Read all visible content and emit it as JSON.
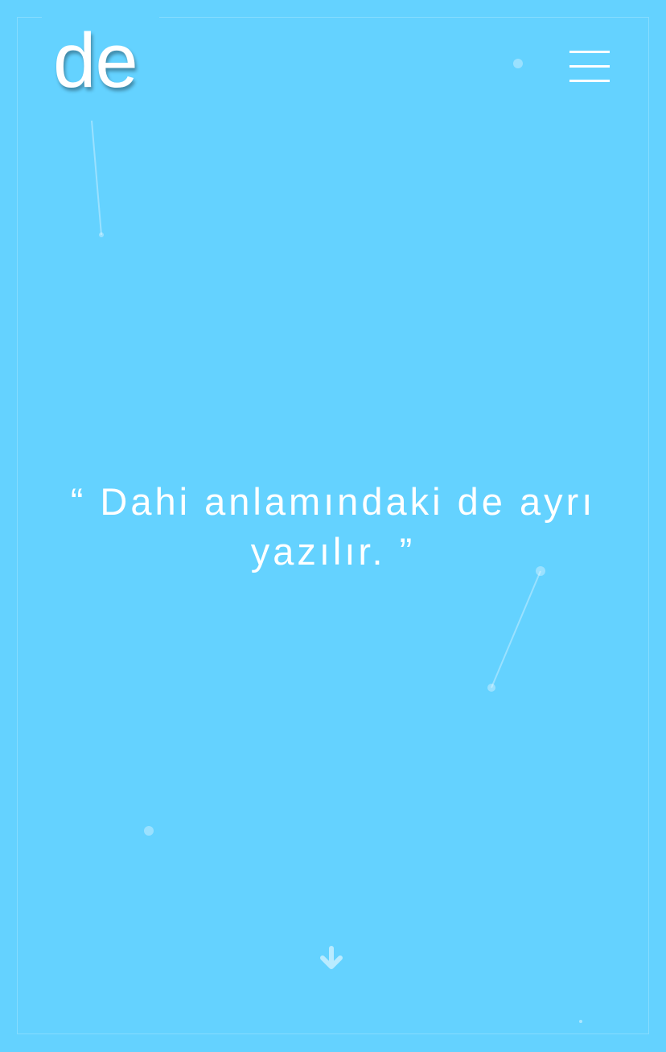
{
  "logo": {
    "text": "de"
  },
  "header": {
    "menu_icon": "hamburger-menu-icon"
  },
  "hero": {
    "quote": "“ Dahi anlamındaki de ayrı yazılır. ”"
  },
  "scroll": {
    "icon": "arrow-down-icon"
  },
  "colors": {
    "background": "#64d2ff",
    "foreground": "#ffffff"
  }
}
